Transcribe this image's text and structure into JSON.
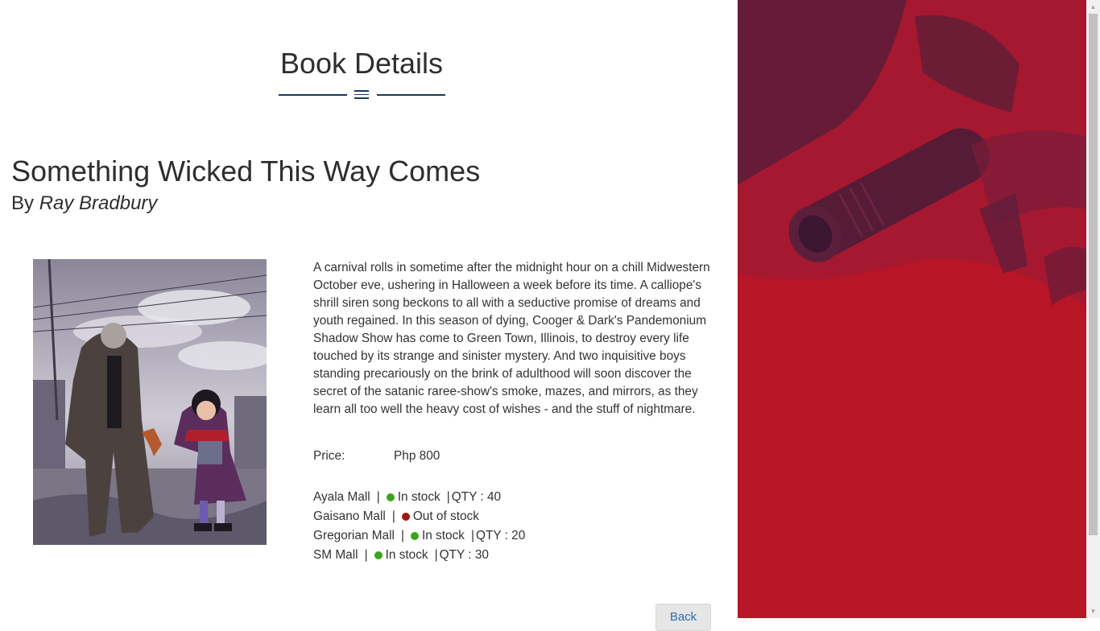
{
  "page": {
    "heading": "Book Details"
  },
  "book": {
    "title": "Something Wicked This Way Comes",
    "by_prefix": "By",
    "author": "Ray Bradbury",
    "description": "A carnival rolls in sometime after the midnight hour on a chill Midwestern October eve, ushering in Halloween a week before its time. A calliope's shrill siren song beckons to all with a seductive promise of dreams and youth regained. In this season of dying, Cooger & Dark's Pandemonium Shadow Show has come to Green Town, Illinois, to destroy every life touched by its strange and sinister mystery. And two inquisitive boys standing precariously on the brink of adulthood will soon discover the secret of the satanic raree-show's smoke, mazes, and mirrors, as they learn all too well the heavy cost of wishes - and the stuff of nightmare.",
    "price_label": "Price:",
    "price_value": "Php 800"
  },
  "stores": [
    {
      "name": "Ayala Mall",
      "status": "In stock",
      "status_color": "#3aa51c",
      "qty": "QTY : 40"
    },
    {
      "name": "Gaisano Mall",
      "status": "Out of stock",
      "status_color": "#a4170f",
      "qty": ""
    },
    {
      "name": "Gregorian Mall",
      "status": "In stock",
      "status_color": "#3aa51c",
      "qty": "QTY : 20"
    },
    {
      "name": "SM Mall",
      "status": "In stock",
      "status_color": "#3aa51c",
      "qty": "QTY : 30"
    }
  ],
  "actions": {
    "back_label": "Back"
  },
  "colors": {
    "accent": "#1c3a5a",
    "side_panel": "#b81526"
  },
  "icons": {
    "divider": "menu-icon"
  }
}
